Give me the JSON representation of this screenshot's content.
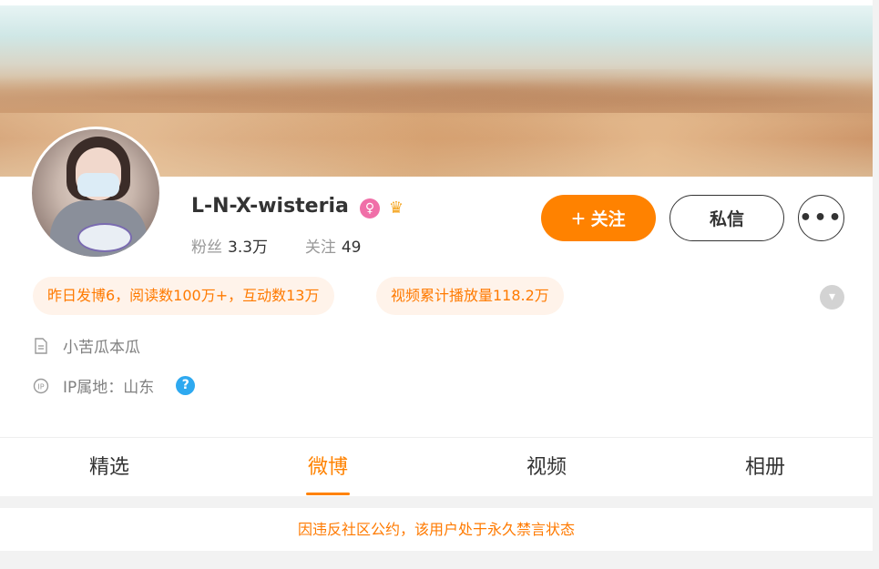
{
  "profile": {
    "name": "L-N-X-wisteria",
    "gender_badge": "♀",
    "vip_badge": "crown-icon",
    "fans_label": "粉丝",
    "fans_count": "3.3万",
    "following_label": "关注",
    "following_count": "49"
  },
  "actions": {
    "follow_plus": "+",
    "follow_label": "关注",
    "message_label": "私信",
    "more_label": "•••"
  },
  "highlights": {
    "yesterday": "昨日发博6，阅读数100万+，互动数13万",
    "video": "视频累计播放量118.2万"
  },
  "info": {
    "bio": "小苦瓜本瓜",
    "ip_location": "IP属地：山东",
    "help": "?"
  },
  "tabs": [
    {
      "label": "精选"
    },
    {
      "label": "微博"
    },
    {
      "label": "视频"
    },
    {
      "label": "相册"
    }
  ],
  "active_tab": "微博",
  "notice": "因违反社区公约，该用户处于永久禁言状态",
  "colors": {
    "accent": "#ff8200",
    "highlight_bg": "#fff3ea",
    "badge_female": "#f06fa8",
    "help_blue": "#2ea9f0"
  }
}
